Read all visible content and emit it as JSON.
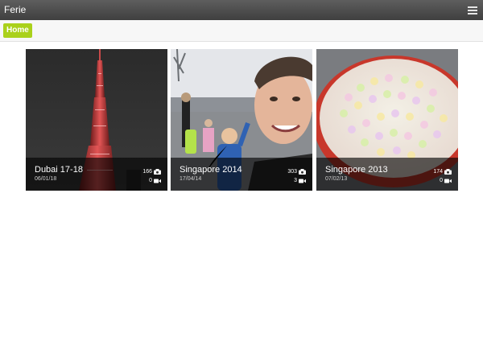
{
  "app": {
    "title": "Ferie"
  },
  "breadcrumb": {
    "home_label": "Home",
    "accent": "#aad11b"
  },
  "albums": [
    {
      "name": "Dubai 17-18",
      "date": "06/01/18",
      "photos": "166",
      "videos": "0"
    },
    {
      "name": "Singapore 2014",
      "date": "17/04/14",
      "photos": "303",
      "videos": "3"
    },
    {
      "name": "Singapore 2013",
      "date": "07/02/13",
      "photos": "174",
      "videos": "0"
    }
  ],
  "icons": {
    "menu": "hamburger-menu-icon",
    "photo_count": "camera-icon",
    "video_count": "video-camera-icon"
  }
}
